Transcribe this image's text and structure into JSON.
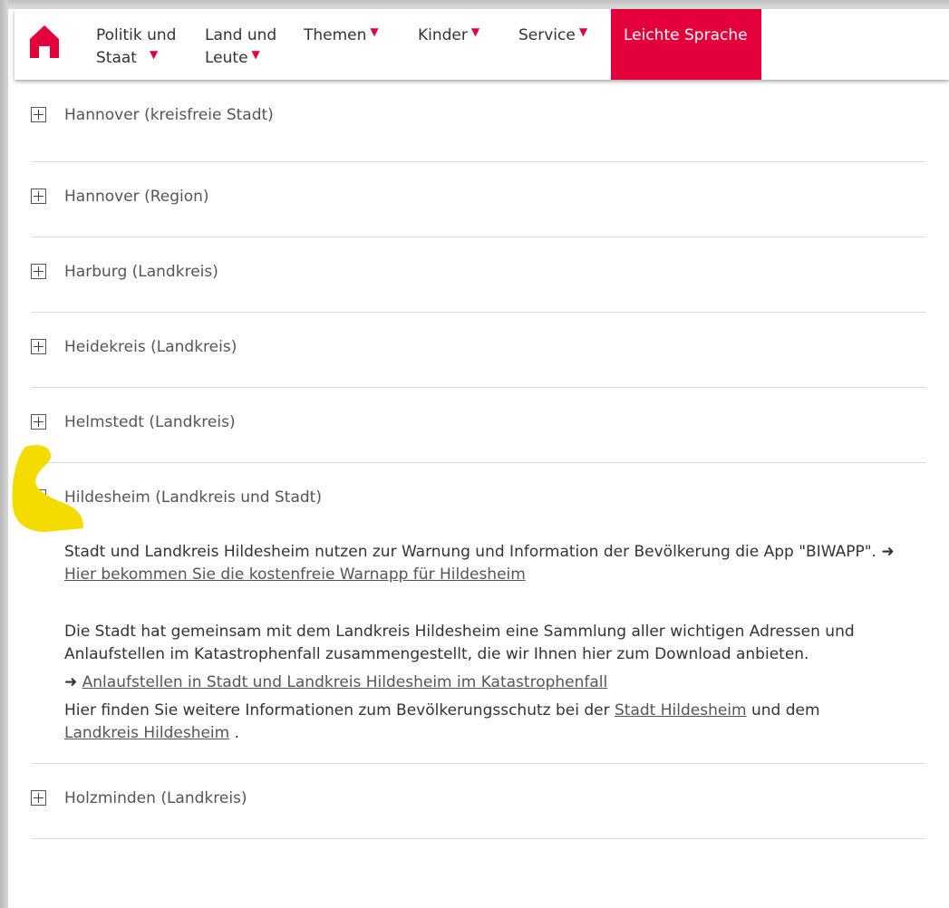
{
  "nav": {
    "items": [
      {
        "line1": "Politik und",
        "line2": "Staat",
        "dropdown": true
      },
      {
        "line1": "Land und",
        "line2": "Leute",
        "dropdown": true
      },
      {
        "line1": "Themen",
        "dropdown": true
      },
      {
        "line1": "Kinder",
        "dropdown": true
      },
      {
        "line1": "Service",
        "dropdown": true
      }
    ],
    "highlight": "Leichte Sprache",
    "dropdown_symbol": "▼",
    "accent_color": "#e4003a"
  },
  "accordion": {
    "items": [
      {
        "title": "Hannover (kreisfreie Stadt)",
        "expanded": false
      },
      {
        "title": "Hannover (Region)",
        "expanded": false
      },
      {
        "title": "Harburg (Landkreis)",
        "expanded": false
      },
      {
        "title": "Heidekreis (Landkreis)",
        "expanded": false
      },
      {
        "title": "Helmstedt (Landkreis)",
        "expanded": false
      },
      {
        "title": "Hildesheim (Landkreis und Stadt)",
        "expanded": true
      },
      {
        "title": "Holzminden (Landkreis)",
        "expanded": false
      }
    ],
    "expanded_content": {
      "p1_text": "Stadt und Landkreis Hildesheim nutzen zur Warnung und Information der Bevölkerung die App \"BIWAPP\". ➜ ",
      "p1_link": "Hier bekommen Sie die kostenfreie Warnapp für Hildesheim",
      "p2_text": "Die Stadt hat gemeinsam mit dem Landkreis Hildesheim eine Sammlung aller wichtigen Adressen und Anlaufstellen im Katastrophenfall zusammengestellt, die wir Ihnen hier zum Download anbieten.",
      "p3_arrow": "➜ ",
      "p3_link": "Anlaufstellen in Stadt und Landkreis Hildesheim im Katastrophenfall",
      "p4_text": "Hier finden Sie weitere Informationen zum Bevölkerungsschutz bei der ",
      "p4_link1": "Stadt Hildesheim",
      "p4_mid": " und dem ",
      "p4_link2": "Landkreis Hildesheim",
      "p4_end": " ."
    }
  }
}
